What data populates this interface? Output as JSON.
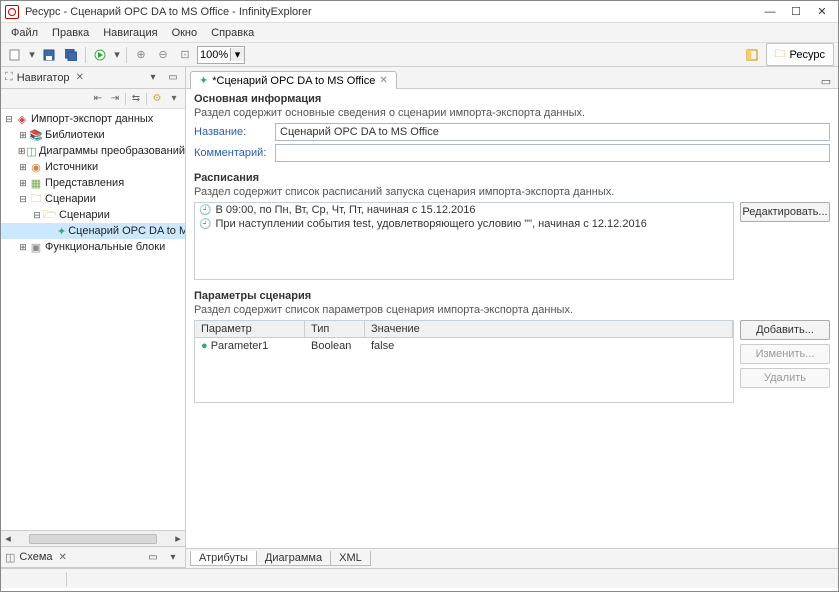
{
  "window": {
    "title": "Ресурс - Сценарий OPC DA to MS Office - InfinityExplorer"
  },
  "menu": [
    "Файл",
    "Правка",
    "Навигация",
    "Окно",
    "Справка"
  ],
  "toolbar": {
    "zoom": "100%",
    "resource_chip": "Ресурс"
  },
  "navigator": {
    "title": "Навигатор",
    "root": "Импорт-экспорт данных",
    "items": [
      "Библиотеки",
      "Диаграммы преобразований",
      "Источники",
      "Представления",
      "Сценарии",
      "Функциональные блоки"
    ],
    "scenarios_sub": "Сценарии",
    "scenario_item": "Сценарий OPC DA to MS Off"
  },
  "schema": {
    "title": "Схема"
  },
  "editor": {
    "tab_title": "*Сценарий OPC DA to MS Office",
    "basic_info": {
      "title": "Основная информация",
      "desc": "Раздел содержит основные сведения о сценарии импорта-экспорта данных.",
      "name_label": "Название:",
      "name_value": "Сценарий OPC DA to MS Office",
      "comment_label": "Комментарий:",
      "comment_value": ""
    },
    "schedules": {
      "title": "Расписания",
      "desc": "Раздел содержит список расписаний запуска сценария импорта-экспорта данных.",
      "items": [
        "В 09:00, по Пн, Вт, Ср, Чт, Пт, начиная с 15.12.2016",
        "При наступлении события test, удовлетворяющего  условию \"\", начиная с 12.12.2016"
      ],
      "edit_btn": "Редактировать..."
    },
    "params": {
      "title": "Параметры сценария",
      "desc": "Раздел содержит список параметров сценария импорта-экспорта данных.",
      "headers": {
        "param": "Параметр",
        "type": "Тип",
        "value": "Значение"
      },
      "rows": [
        {
          "param": "Parameter1",
          "type": "Boolean",
          "value": "false"
        }
      ],
      "add_btn": "Добавить...",
      "edit_btn": "Изменить...",
      "del_btn": "Удалить"
    },
    "bottom_tabs": [
      "Атрибуты",
      "Диаграмма",
      "XML"
    ]
  }
}
